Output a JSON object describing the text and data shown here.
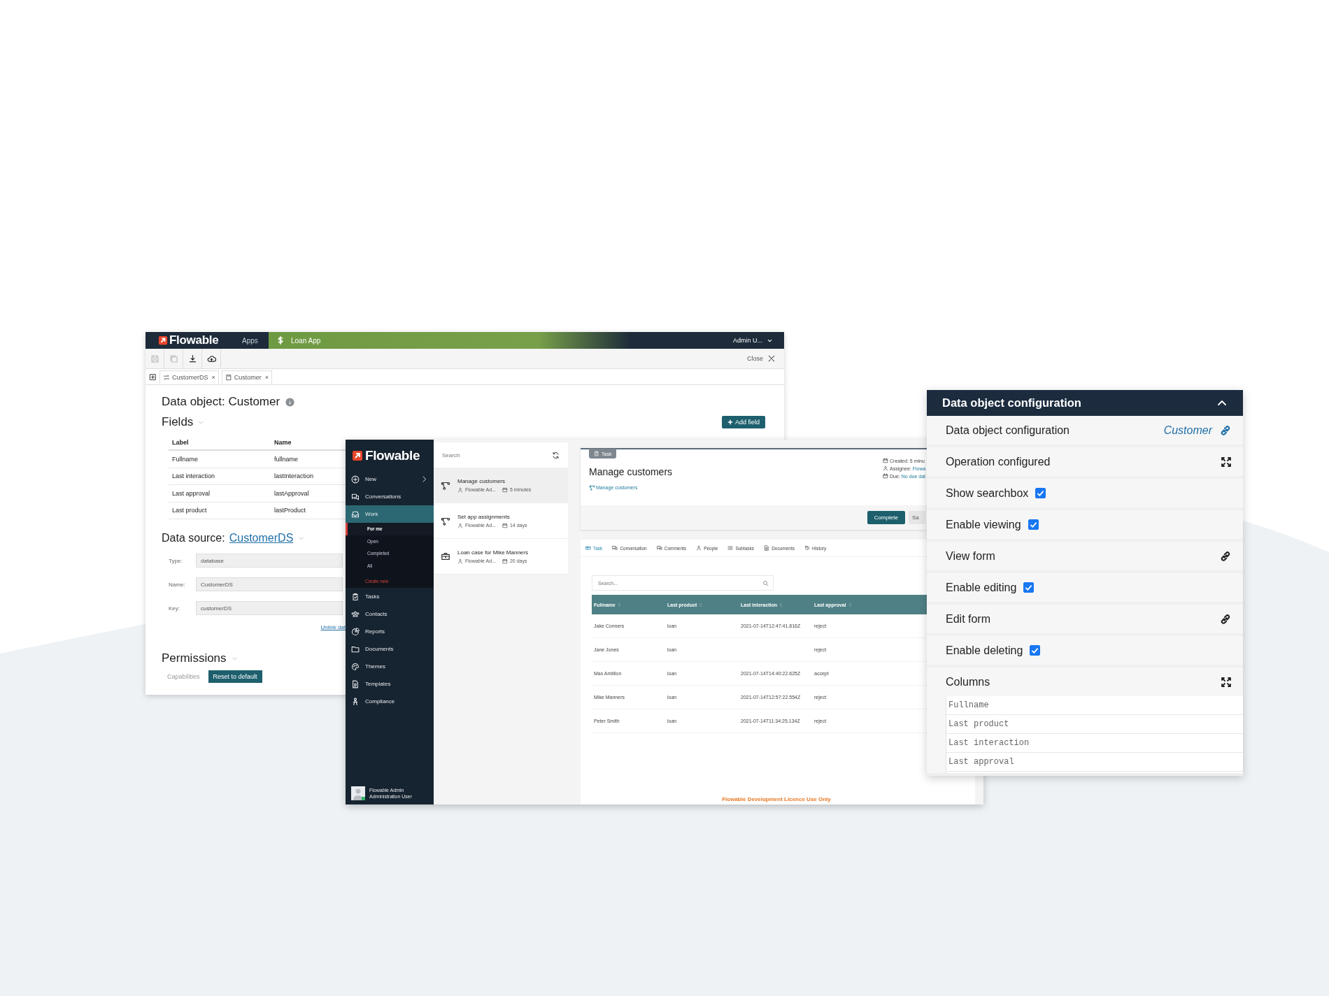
{
  "editor": {
    "logo": "Flowable",
    "apps": "Apps",
    "app": "Loan App",
    "user": "Admin U...",
    "close": "Close",
    "toolbar": [
      {
        "kind": "save",
        "disabled": true
      },
      {
        "kind": "save-all",
        "disabled": true
      },
      {
        "kind": "download",
        "disabled": false
      },
      {
        "kind": "upload",
        "disabled": false
      }
    ],
    "tabs": [
      {
        "kind": "source",
        "label": "CustomerDS",
        "close_mark": "×"
      },
      {
        "kind": "object",
        "label": "Customer",
        "close_mark": "×"
      }
    ],
    "title": "Data object: Customer",
    "fields_heading": "Fields",
    "add_field": "Add field",
    "fields_columns": [
      "Label",
      "Name"
    ],
    "fields_rows": [
      [
        "Fullname",
        "fullname"
      ],
      [
        "Last interaction",
        "lastInteraction"
      ],
      [
        "Last approval",
        "lastApproval"
      ],
      [
        "Last product",
        "lastProduct"
      ]
    ],
    "source_label": "Data source:",
    "source_link": "CustomerDS",
    "source_fields": [
      {
        "label": "Type:",
        "value": "database"
      },
      {
        "label": "Name:",
        "value": "CustomerDS"
      },
      {
        "label": "Key:",
        "value": "customerDS"
      }
    ],
    "unlink": "Unlink dat",
    "permissions_heading": "Permissions",
    "capabilities": "Capabilities",
    "reset": "Reset to default"
  },
  "work": {
    "logo": "Flowable",
    "nav": [
      {
        "label": "New",
        "selected": false,
        "submenu": true
      },
      {
        "label": "Conversations",
        "selected": false,
        "submenu": false
      },
      {
        "label": "Work",
        "selected": true,
        "submenu": false,
        "children": [
          {
            "label": "For me",
            "selected": true
          },
          {
            "label": "Open",
            "selected": false
          },
          {
            "label": "Completed",
            "selected": false
          },
          {
            "label": "All",
            "selected": false
          }
        ],
        "action": "Create new"
      },
      {
        "label": "Tasks",
        "selected": false,
        "submenu": false
      },
      {
        "label": "Contacts",
        "selected": false,
        "submenu": false
      },
      {
        "label": "Reports",
        "selected": false,
        "submenu": false
      },
      {
        "label": "Documents",
        "selected": false,
        "submenu": false
      },
      {
        "label": "Themes",
        "selected": false,
        "submenu": false
      },
      {
        "label": "Templates",
        "selected": false,
        "submenu": false
      },
      {
        "label": "Compliance",
        "selected": false,
        "submenu": false
      }
    ],
    "user": {
      "name": "Flowable Admin",
      "role": "Administration User"
    },
    "search_placeholder": "Search",
    "items": [
      {
        "kind": "process",
        "title": "Manage customers",
        "assignee": "Flowable Ad...",
        "age": "5 minutes",
        "selected": true
      },
      {
        "kind": "process",
        "title": "Set app assignments",
        "assignee": "Flowable Ad...",
        "age": "14 days",
        "selected": false
      },
      {
        "kind": "case",
        "title": "Loan case for Mike Manners",
        "assignee": "Flowable Ad...",
        "age": "20 days",
        "selected": false
      }
    ],
    "task": {
      "badge": "Task",
      "title": "Manage customers",
      "link": "Manage customers",
      "meta": [
        {
          "kind": "created",
          "label": "Created:",
          "value": "5 minu",
          "link": false
        },
        {
          "kind": "assignee",
          "label": "Assignee:",
          "value": "Flowa",
          "link": true
        },
        {
          "kind": "due",
          "label": "Due:",
          "value": "No due dat",
          "link": true
        }
      ],
      "complete": "Complete",
      "save": "Sa"
    },
    "tabs": [
      {
        "kind": "task",
        "label": "Task",
        "selected": true
      },
      {
        "kind": "chat",
        "label": "Conversation",
        "selected": false
      },
      {
        "kind": "chat",
        "label": "Comments",
        "selected": false
      },
      {
        "kind": "person",
        "label": "People",
        "selected": false
      },
      {
        "kind": "list",
        "label": "Subtasks",
        "selected": false
      },
      {
        "kind": "document",
        "label": "Documents",
        "selected": false
      },
      {
        "kind": "history",
        "label": "History",
        "selected": false
      }
    ],
    "table_search_placeholder": "Search...",
    "columns": [
      "Fullname",
      "Last product",
      "Last interaction",
      "Last approval"
    ],
    "rows": [
      [
        "Jake Conners",
        "loan",
        "2021-07-14T12:47:41.816Z",
        "reject"
      ],
      [
        "Jane Jones",
        "loan",
        "",
        "reject"
      ],
      [
        "Max Amillion",
        "loan",
        "2021-07-14T14:40:22.625Z",
        "accept"
      ],
      [
        "Mike Manners",
        "loan",
        "2021-07-14T12:57:22.554Z",
        "reject"
      ],
      [
        "Peter Smith",
        "loan",
        "2021-07-14T11:34:25.134Z",
        "reject"
      ]
    ],
    "licence": "Flowable Development Licence Use Only"
  },
  "config": {
    "title": "Data object configuration",
    "rows": [
      {
        "kind": "link",
        "label": "Data object configuration",
        "value": "Customer"
      },
      {
        "kind": "expand",
        "label": "Operation configured"
      },
      {
        "kind": "checkbox",
        "label": "Show searchbox",
        "checked": true
      },
      {
        "kind": "checkbox",
        "label": "Enable viewing",
        "checked": true
      },
      {
        "kind": "link",
        "label": "View form"
      },
      {
        "kind": "checkbox",
        "label": "Enable editing",
        "checked": true
      },
      {
        "kind": "link",
        "label": "Edit form"
      },
      {
        "kind": "checkbox",
        "label": "Enable deleting",
        "checked": true
      },
      {
        "kind": "expand",
        "label": "Columns",
        "items": [
          "Fullname",
          "Last product",
          "Last interaction",
          "Last approval"
        ]
      }
    ]
  }
}
